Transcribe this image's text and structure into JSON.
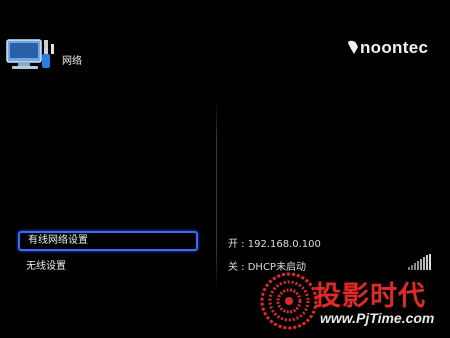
{
  "header": {
    "title": "网络",
    "icon": "network-settings-icon"
  },
  "brand": {
    "name": "noontec"
  },
  "menu": {
    "items": [
      {
        "label": "有线网络设置",
        "selected": true
      },
      {
        "label": "无线设置",
        "selected": false
      }
    ]
  },
  "status": {
    "wired": "开 : 192.168.0.100",
    "wireless": "关 : DHCP未启动",
    "signal_icon": "signal-strength-icon"
  },
  "watermark": {
    "cn": "投影时代",
    "url": "www.PjTime.com"
  },
  "colors": {
    "background": "#000000",
    "selection_border": "#3c6cff",
    "watermark_red": "#e02a2a"
  }
}
